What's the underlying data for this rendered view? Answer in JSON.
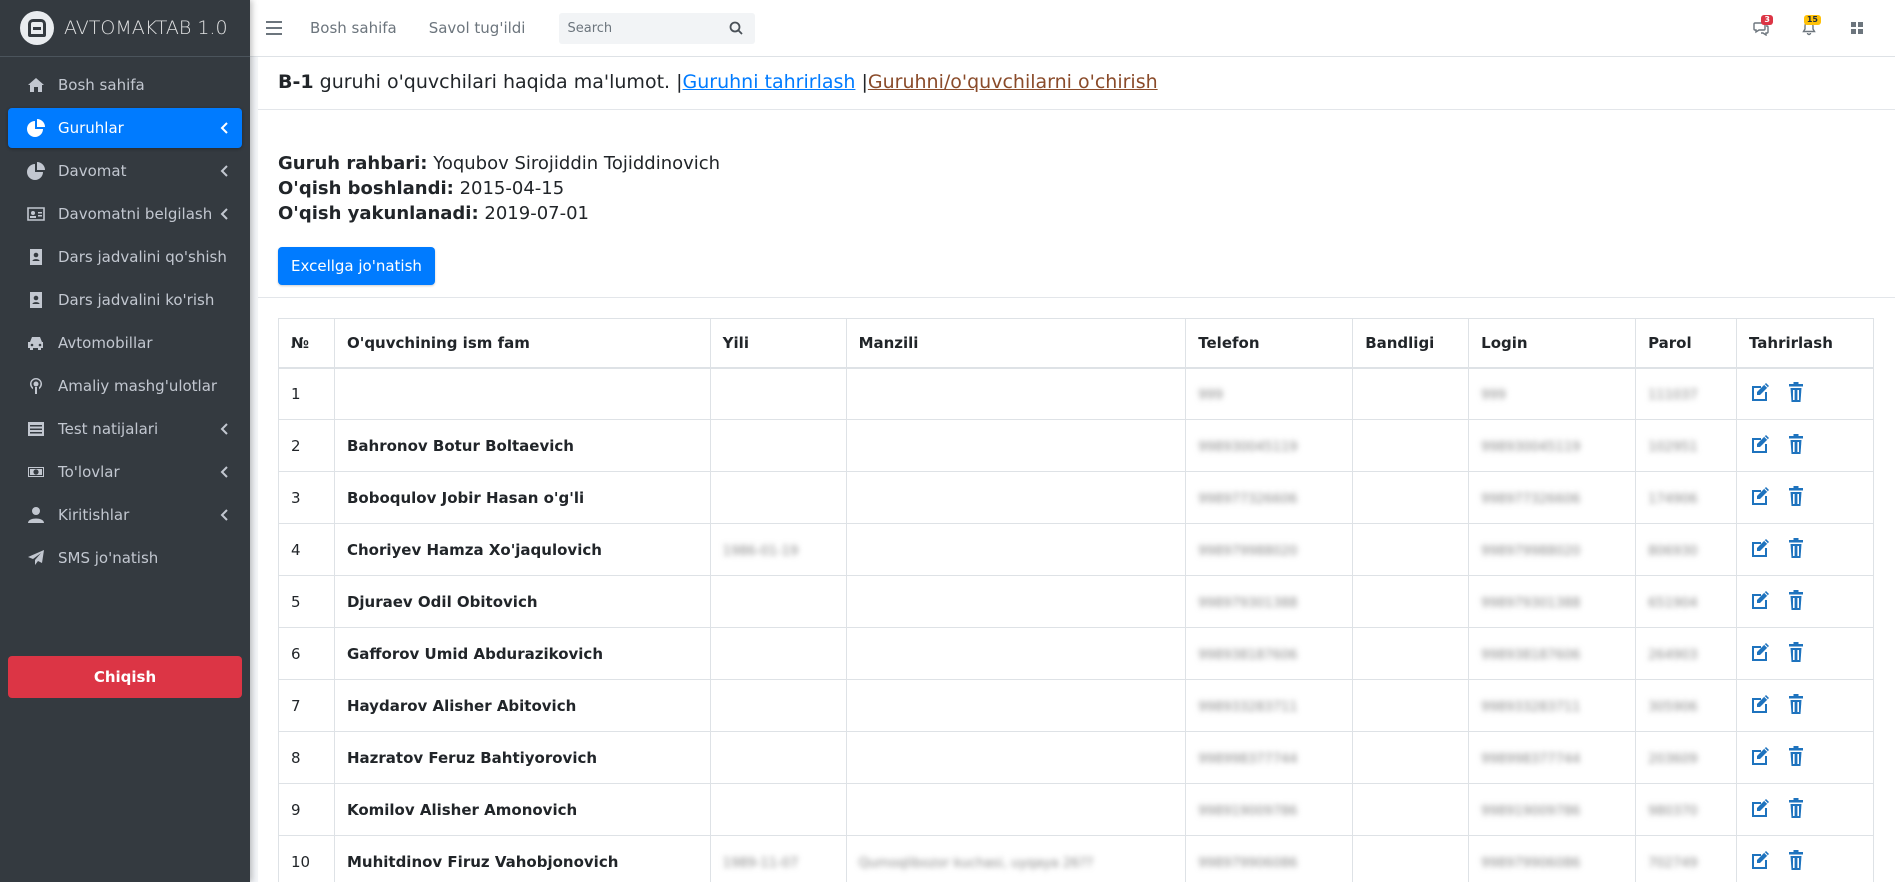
{
  "brand": {
    "title": "AVTOMAKTAB 1.0"
  },
  "sidebar": {
    "items": [
      {
        "label": "Bosh sahifa",
        "icon": "home-icon",
        "chevron": false,
        "active": false
      },
      {
        "label": "Guruhlar",
        "icon": "pie-chart-icon",
        "chevron": true,
        "active": true
      },
      {
        "label": "Davomat",
        "icon": "pie-chart-icon",
        "chevron": true,
        "active": false
      },
      {
        "label": "Davomatni belgilash",
        "icon": "id-card-icon",
        "chevron": true,
        "active": false
      },
      {
        "label": "Dars jadvalini qo'shish",
        "icon": "contact-book-icon",
        "chevron": false,
        "active": false
      },
      {
        "label": "Dars jadvalini ko'rish",
        "icon": "contact-book-icon",
        "chevron": false,
        "active": false
      },
      {
        "label": "Avtomobillar",
        "icon": "car-icon",
        "chevron": false,
        "active": false
      },
      {
        "label": "Amaliy mashg'ulotlar",
        "icon": "podcast-icon",
        "chevron": false,
        "active": false
      },
      {
        "label": "Test natijalari",
        "icon": "list-box-icon",
        "chevron": true,
        "active": false
      },
      {
        "label": "To'lovlar",
        "icon": "money-icon",
        "chevron": true,
        "active": false
      },
      {
        "label": "Kiritishlar",
        "icon": "user-icon",
        "chevron": true,
        "active": false
      },
      {
        "label": "SMS jo'natish",
        "icon": "paper-plane-icon",
        "chevron": false,
        "active": false
      }
    ],
    "logout_label": "Chiqish"
  },
  "header": {
    "links": [
      "Bosh sahifa",
      "Savol tug'ildi"
    ],
    "search_placeholder": "Search",
    "messages_badge": "3",
    "notifications_badge": "15"
  },
  "group": {
    "name": "B-1",
    "title_rest": "guruhi o'quvchilari haqida ma'lumot.",
    "sep": "|",
    "edit_link": "Guruhni tahrirlash",
    "delete_link": "Guruhni/o'quvchilarni o'chirish",
    "leader_label": "Guruh rahbari:",
    "leader_value": "Yoqubov Sirojiddin Tojiddinovich",
    "start_label": "O'qish boshlandi:",
    "start_value": "2015-04-15",
    "end_label": "O'qish yakunlanadi:",
    "end_value": "2019-07-01",
    "excel_button": "Excellga jo'natish"
  },
  "table": {
    "headers": [
      "№",
      "O'quvchining ism fam",
      "Yili",
      "Manzili",
      "Telefon",
      "Bandligi",
      "Login",
      "Parol",
      "Tahrirlash"
    ],
    "rows": [
      {
        "n": "1",
        "name": "",
        "year": "",
        "address": "",
        "phone": "999",
        "job": "",
        "login": "999",
        "pass": "111037"
      },
      {
        "n": "2",
        "name": "Bahronov Botur Boltaevich",
        "year": "",
        "address": "",
        "phone": "998930045119",
        "job": "",
        "login": "998930045119",
        "pass": "102951"
      },
      {
        "n": "3",
        "name": "Boboqulov Jobir Hasan o'g'li",
        "year": "",
        "address": "",
        "phone": "998977326606",
        "job": "",
        "login": "998977326606",
        "pass": "174906"
      },
      {
        "n": "4",
        "name": "Choriyev Hamza Xo'jaqulovich",
        "year": "1986-01-19",
        "address": "",
        "phone": "998979988020",
        "job": "",
        "login": "998979988020",
        "pass": "806930"
      },
      {
        "n": "5",
        "name": "Djuraev Odil Obitovich",
        "year": "",
        "address": "",
        "phone": "998979301388",
        "job": "",
        "login": "998979301388",
        "pass": "651904"
      },
      {
        "n": "6",
        "name": "Gafforov Umid Abdurazikovich",
        "year": "",
        "address": "",
        "phone": "998938187606",
        "job": "",
        "login": "998938187606",
        "pass": "264903"
      },
      {
        "n": "7",
        "name": "Haydarov Alisher Abitovich",
        "year": "",
        "address": "",
        "phone": "998933283711",
        "job": "",
        "login": "998933283711",
        "pass": "305906"
      },
      {
        "n": "8",
        "name": "Hazratov Feruz Bahtiyorovich",
        "year": "",
        "address": "",
        "phone": "998998377744",
        "job": "",
        "login": "998998377744",
        "pass": "203609"
      },
      {
        "n": "9",
        "name": "Komilov Alisher Amonovich",
        "year": "",
        "address": "",
        "phone": "998919009786",
        "job": "",
        "login": "998919009786",
        "pass": "980370"
      },
      {
        "n": "10",
        "name": "Muhitdinov Firuz Vahobjonovich",
        "year": "1989-11-07",
        "address": "Qumoqlibozor kuchasi, uyqaya 26??",
        "phone": "998979906086",
        "job": "",
        "login": "998979906086",
        "pass": "702749"
      }
    ]
  },
  "colors": {
    "primary": "#007bff",
    "danger": "#dc3545",
    "sidebar": "#343a40",
    "warning": "#ffc107"
  }
}
